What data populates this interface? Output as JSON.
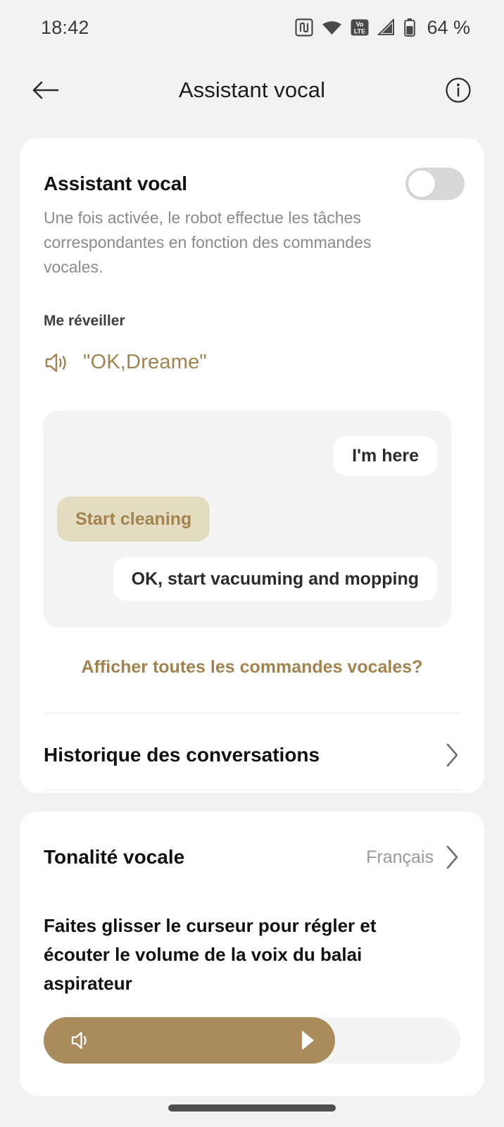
{
  "status_bar": {
    "time": "18:42",
    "battery_percent": "64 %",
    "icons": [
      "nfc-icon",
      "wifi-icon",
      "volte-icon",
      "signal-icon",
      "battery-icon"
    ]
  },
  "app_bar": {
    "back_icon": "back-arrow-icon",
    "title": "Assistant vocal",
    "info_icon": "info-icon"
  },
  "assistant_card": {
    "title": "Assistant vocal",
    "toggle_state": "off",
    "description": "Une fois activée, le robot effectue les tâches correspondantes en fonction des commandes vocales.",
    "wake_label": "Me réveiller",
    "wake_phrase": "\"OK,Dreame\"",
    "wake_icon": "speaker-icon",
    "chat": [
      {
        "text": "I'm here",
        "side": "right",
        "style": "white"
      },
      {
        "text": "Start cleaning",
        "side": "left",
        "style": "tan"
      },
      {
        "text": "OK, start vacuuming and mopping",
        "side": "right",
        "style": "white"
      }
    ],
    "show_all_commands": "Afficher toutes les commandes vocales?",
    "history_label": "Historique des conversations",
    "history_chevron": "chevron-right-icon"
  },
  "tone_card": {
    "title": "Tonalité vocale",
    "value": "Français",
    "chevron": "chevron-right-icon",
    "hint": "Faites glisser le curseur pour régler et écouter le volume de la voix du balai aspirateur",
    "slider": {
      "fill_percent": 70,
      "speaker_icon": "speaker-icon",
      "thumb_icon": "play-triangle-icon"
    }
  },
  "colors": {
    "accent": "#a2834f",
    "slider_fill": "#a98b5c",
    "bubble_tan": "#e4dcc1",
    "page_background": "#f2f2f2",
    "card_background": "#ffffff"
  },
  "home_indicator": "home-indicator"
}
